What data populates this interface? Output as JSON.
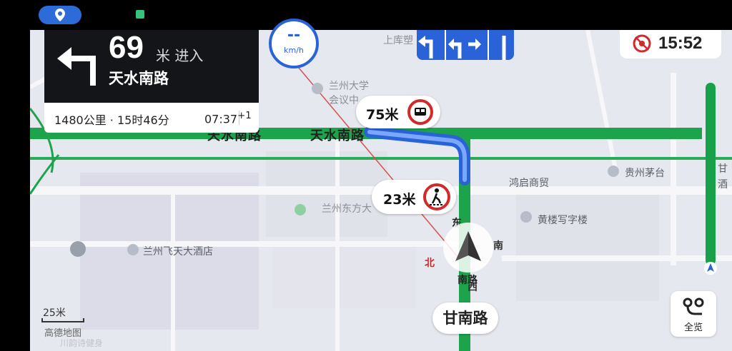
{
  "status_bar": {
    "location_icon": "location-pin-icon"
  },
  "map_labels": {
    "poi_1": "上库塑",
    "poi_2": "兰州大学",
    "poi_3": "会议中",
    "road_main_1": "天水南路",
    "road_main_2": "天水南路",
    "poi_4": "鸿启商贸",
    "poi_5": "贵州茅台",
    "poi_6": "兰州东方大",
    "poi_7": "黄楼写字楼",
    "poi_8": "兰州飞天大酒店",
    "poi_9": "甘",
    "poi_10": "酒",
    "road_vertical": "甘南路",
    "road_vertical_bottom": "南路",
    "road_side_char": "东"
  },
  "turn_card": {
    "distance": "69",
    "unit_action": "米 进入",
    "road": "天水南路",
    "turn_icon": "turn-left-arrow-icon"
  },
  "trip": {
    "summary": "1480公里 · 15时46分",
    "eta": "07:37",
    "eta_days": "+1"
  },
  "speed": {
    "value": "--",
    "unit": "km/h"
  },
  "clock": {
    "time": "15:52",
    "icon": "no-signal-icon"
  },
  "alerts": [
    {
      "distance": "75米",
      "icon": "bus-lane-camera-icon"
    },
    {
      "distance": "23米",
      "icon": "pedestrian-crossing-icon"
    }
  ],
  "compass": {
    "north": "北",
    "east": "东",
    "south": "南",
    "west": "西"
  },
  "current_road": "甘南路",
  "overview": {
    "label": "全览",
    "icon": "overview-route-icon"
  },
  "scale": {
    "label": "25米"
  },
  "brand": "高德地图",
  "bottom_faded": "川韵诗健身",
  "colors": {
    "route_green": "#1ea34d",
    "route_blue": "#2a62d8",
    "card_dark": "#141518",
    "alert_red": "#d22a2a"
  }
}
